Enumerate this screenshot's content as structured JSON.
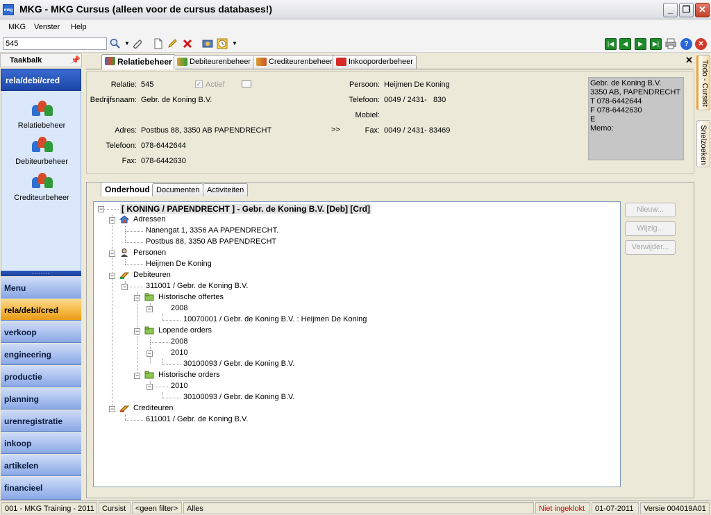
{
  "window": {
    "title": "MKG - MKG Cursus (alleen voor de cursus databases!)",
    "app_icon_text": "mkg",
    "buttons": {
      "minimize": "_",
      "restore": "❐",
      "close": "✕"
    }
  },
  "menubar": {
    "items": [
      "MKG",
      "Venster",
      "Help"
    ]
  },
  "toolbar": {
    "search_value": "545",
    "icons": [
      "search-icon",
      "attach-icon",
      "new-document-icon",
      "edit-icon",
      "delete-icon",
      "settings-icon",
      "clock-icon"
    ],
    "nav_icons": [
      "first-icon",
      "previous-icon",
      "next-icon",
      "last-icon",
      "print-icon",
      "help-icon",
      "close-icon"
    ]
  },
  "left_panel": {
    "title": "Taakbalk",
    "pin": "ᵠ",
    "section_title": "rela/debi/cred",
    "modules": [
      "Relatiebeheer",
      "Debiteurbeheer",
      "Crediteurbeheer"
    ],
    "splitter": "........",
    "nav_items": [
      "Menu",
      "rela/debi/cred",
      "verkoop",
      "engineering",
      "productie",
      "planning",
      "urenregistratie",
      "inkoop",
      "artikelen",
      "financieel"
    ],
    "active_nav": "rela/debi/cred"
  },
  "tabs": {
    "items": [
      "Relatiebeheer",
      "Debiteurenbeheer",
      "Crediteurenbeheer",
      "Inkooporderbeheer"
    ],
    "active": "Relatiebeheer",
    "close": "✕"
  },
  "relation": {
    "labels": {
      "relatie": "Relatie:",
      "actief": "Actief",
      "bedrijfsnaam": "Bedrijfsnaam:",
      "adres": "Adres:",
      "telefoon": "Telefoon:",
      "fax": "Fax:",
      "persoon": "Persoon:",
      "telefoon2": "Telefoon:",
      "mobiel": "Mobiel:",
      "fax2": "Fax:"
    },
    "relatie": "545",
    "actief_checked": "✓",
    "bedrijfsnaam": "Gebr. de Koning B.V.",
    "adres": "Postbus 88, 3350 AB PAPENDRECHT",
    "telefoon": "078-6442644",
    "fax": "078-6442630",
    "expand": ">>",
    "persoon": "Heijmen De Koning",
    "persoon_telefoon": "0049 / 2431-   830",
    "persoon_mobiel": "",
    "persoon_fax": "0049 / 2431- 83469",
    "address_box": "Gebr. de Koning B.V.\n3350 AB, PAPENDRECHT\nT 078-6442644\nF 078-6442630\nE\nMemo:"
  },
  "subtabs": {
    "items": [
      "Onderhoud",
      "Documenten",
      "Activiteiten"
    ],
    "active": "Onderhoud"
  },
  "tree": {
    "root": "[ KONING / PAPENDRECHT ] - Gebr. de Koning B.V. [Deb] [Crd]",
    "adressen": "Adressen",
    "adres1": "Nanengat 1, 3356 AA  PAPENDRECHT.",
    "adres2": "Postbus 88, 3350 AB  PAPENDRECHT",
    "personen": "Personen",
    "persoon1": "Heijmen De Koning",
    "debiteuren": "Debiteuren",
    "debiteur1": "311001 / Gebr. de Koning B.V.",
    "hist_offertes": "Historische offertes",
    "year_2008a": "2008",
    "offerte1": "10070001 / Gebr. de Koning B.V. : Heijmen De Koning",
    "lopende_orders": "Lopende orders",
    "year_2008b": "2008",
    "year_2010a": "2010",
    "order1": "30100093 / Gebr. de Koning B.V.",
    "hist_orders": "Historische orders",
    "year_2010b": "2010",
    "order2": "30100093 / Gebr. de Koning B.V.",
    "crediteuren": "Crediteuren",
    "crediteur1": "611001 / Gebr. de Koning B.V."
  },
  "side_buttons": {
    "nieuw": "Nieuw...",
    "wijzig": "Wijzig...",
    "verwijder": "Verwijder..."
  },
  "right_tabs": [
    "Todo - Cursist",
    "Snelzoeken"
  ],
  "statusbar": {
    "company": "001 - MKG Training - 2011",
    "user": "Cursist",
    "filter": "<geen filter>",
    "scope": "Alles",
    "clock_status": "Niet ingeklokt",
    "clock_status_color": "#cc0000",
    "date": "01-07-2011",
    "version": "Versie 004019A01"
  }
}
